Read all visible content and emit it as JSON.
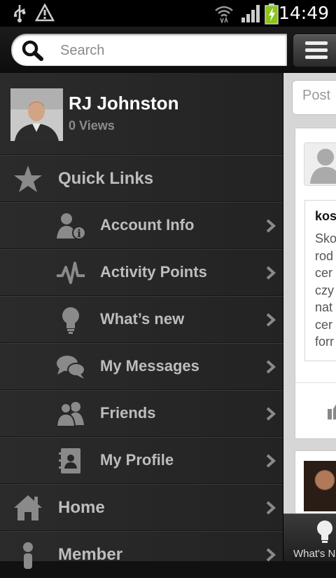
{
  "status_bar": {
    "time": "14:49",
    "icons": [
      "usb-icon",
      "warning-icon",
      "wifi-icon",
      "signal-icon",
      "battery-charging-icon"
    ]
  },
  "search": {
    "placeholder": "Search"
  },
  "profile": {
    "name": "RJ Johnston",
    "views": "0 Views"
  },
  "menu": {
    "quick_links": {
      "label": "Quick Links",
      "icon": "star-icon"
    },
    "items": [
      {
        "label": "Account Info",
        "icon": "account-info-icon"
      },
      {
        "label": "Activity Points",
        "icon": "activity-icon"
      },
      {
        "label": "What’s new",
        "icon": "lightbulb-icon"
      },
      {
        "label": "My Messages",
        "icon": "chat-bubbles-icon"
      },
      {
        "label": "Friends",
        "icon": "friends-icon"
      },
      {
        "label": "My Profile",
        "icon": "contact-book-icon"
      }
    ],
    "home": {
      "label": "Home",
      "icon": "home-icon"
    },
    "member": {
      "label": "Member",
      "icon": "member-icon"
    }
  },
  "content": {
    "post_placeholder": "Post",
    "card_title": "kos",
    "card_text": [
      "Sko",
      "rod",
      "cer",
      "czy",
      "nat",
      "cer",
      "forr"
    ],
    "tab_label": "What's N"
  },
  "colors": {
    "sidebar_bg": "#262626",
    "label": "#bdbdbd",
    "status_bg": "#000000",
    "battery": "#8bc51c"
  }
}
